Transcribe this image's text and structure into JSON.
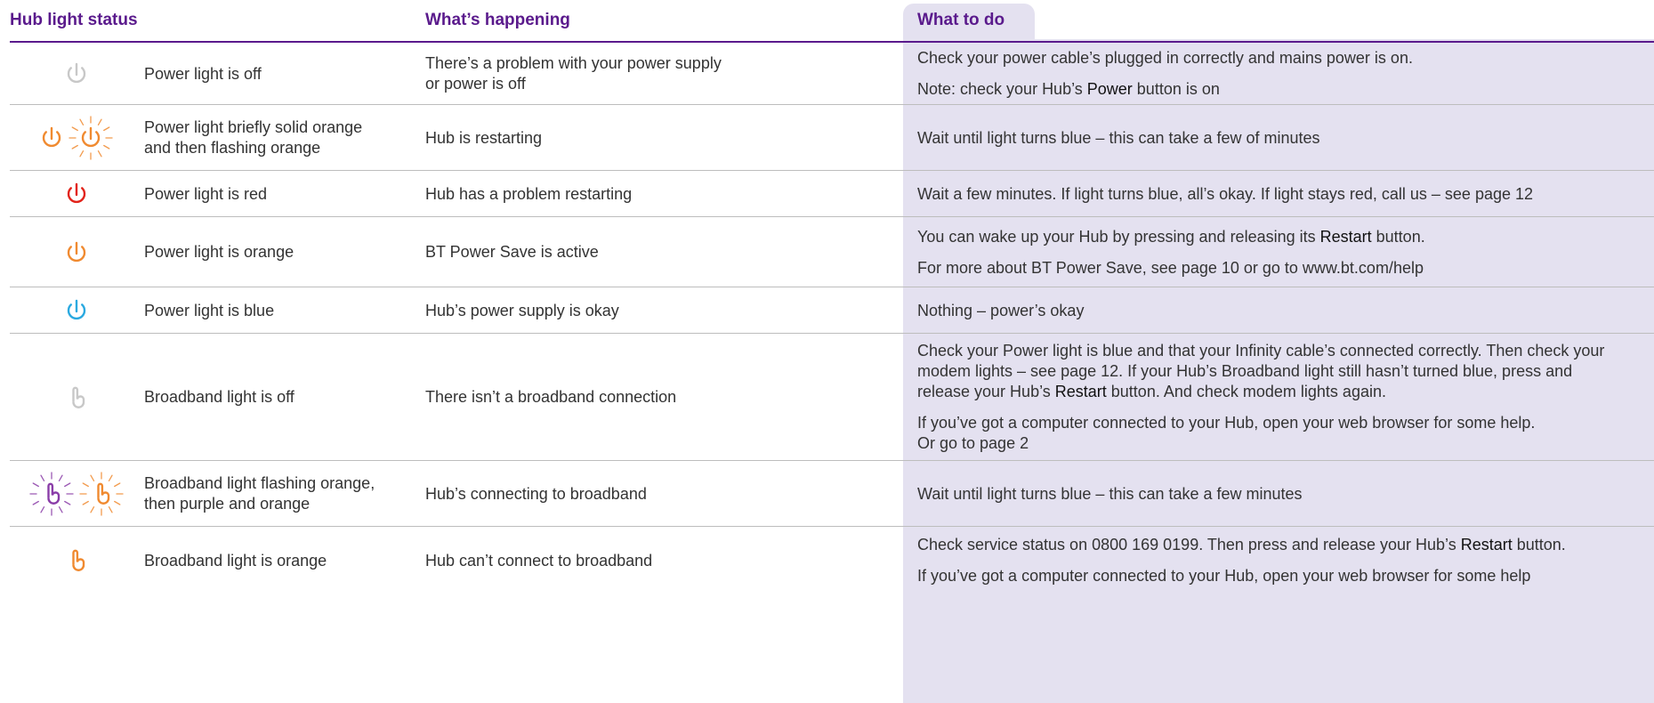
{
  "colors": {
    "heading_purple": "#5a1a8c",
    "todo_background": "#e4e1f0",
    "power_off_grey": "#c8c8c8",
    "orange": "#f08a30",
    "red": "#e2231a",
    "blue": "#2aa9e0",
    "purple": "#8a3da8"
  },
  "header": {
    "status": "Hub light status",
    "happening": "What’s happening",
    "todo": "What to do"
  },
  "rows": [
    {
      "icons": [
        "power-icon-grey"
      ],
      "status": [
        "Power light is off"
      ],
      "happening": [
        "There’s a problem with your power supply",
        "or power is off"
      ],
      "todo": [
        {
          "text": "Check your power cable’s plugged in correctly and mains power is on."
        },
        {
          "pre": "Note: check your Hub’s ",
          "em": "Power",
          "post": " button is on"
        }
      ]
    },
    {
      "icons": [
        "power-icon-orange",
        "power-icon-orange-flashing"
      ],
      "status": [
        "Power light briefly solid orange",
        "and then flashing orange"
      ],
      "happening": [
        "Hub is restarting"
      ],
      "todo": [
        {
          "text": "Wait until light turns blue – this can take a few of minutes"
        }
      ]
    },
    {
      "icons": [
        "power-icon-red"
      ],
      "status": [
        "Power light is red"
      ],
      "happening": [
        "Hub has a problem restarting"
      ],
      "todo": [
        {
          "text": "Wait a few minutes. If light turns blue, all’s okay. If light stays red, call us – see page 12"
        }
      ]
    },
    {
      "icons": [
        "power-icon-orange"
      ],
      "status": [
        "Power light is orange"
      ],
      "happening": [
        "BT Power Save is active"
      ],
      "todo": [
        {
          "pre": "You can wake up your Hub by pressing and releasing its ",
          "em": "Restart",
          "post": " button."
        },
        {
          "text": "For more about BT Power Save, see page 10 or go to www.bt.com/help"
        }
      ]
    },
    {
      "icons": [
        "power-icon-blue"
      ],
      "status": [
        "Power light is blue"
      ],
      "happening": [
        "Hub’s power supply is okay"
      ],
      "todo": [
        {
          "text": "Nothing – power’s okay"
        }
      ]
    },
    {
      "icons": [
        "broadband-icon-grey"
      ],
      "status": [
        "Broadband light is off"
      ],
      "happening": [
        "There isn’t a broadband connection"
      ],
      "todo": [
        {
          "lines": [
            "Check your Power light is blue and that your Infinity cable’s connected correctly. Then check your",
            "modem lights – see page 12. If your Hub’s Broadband light still hasn’t turned blue, press and"
          ],
          "pre": "release your Hub’s ",
          "em": "Restart",
          "post": " button. And check modem lights again."
        },
        {
          "lines": [
            "If you’ve got a computer connected to your Hub, open your web browser for some help.",
            "Or go to page 2"
          ]
        }
      ]
    },
    {
      "icons": [
        "broadband-icon-purple-flashing",
        "broadband-icon-orange-flashing"
      ],
      "status": [
        "Broadband light flashing orange,",
        "then purple and orange"
      ],
      "happening": [
        "Hub’s connecting to broadband"
      ],
      "todo": [
        {
          "text": "Wait until light turns blue  – this can take a few minutes"
        }
      ]
    },
    {
      "icons": [
        "broadband-icon-orange"
      ],
      "status": [
        "Broadband light is orange"
      ],
      "happening": [
        "Hub can’t connect to broadband"
      ],
      "todo": [
        {
          "pre": "Check service status on 0800 169 0199. Then press and release your Hub’s ",
          "em": "Restart",
          "post": " button."
        },
        {
          "text": "If you’ve got a computer connected to your Hub, open your web browser for some help"
        }
      ]
    }
  ]
}
